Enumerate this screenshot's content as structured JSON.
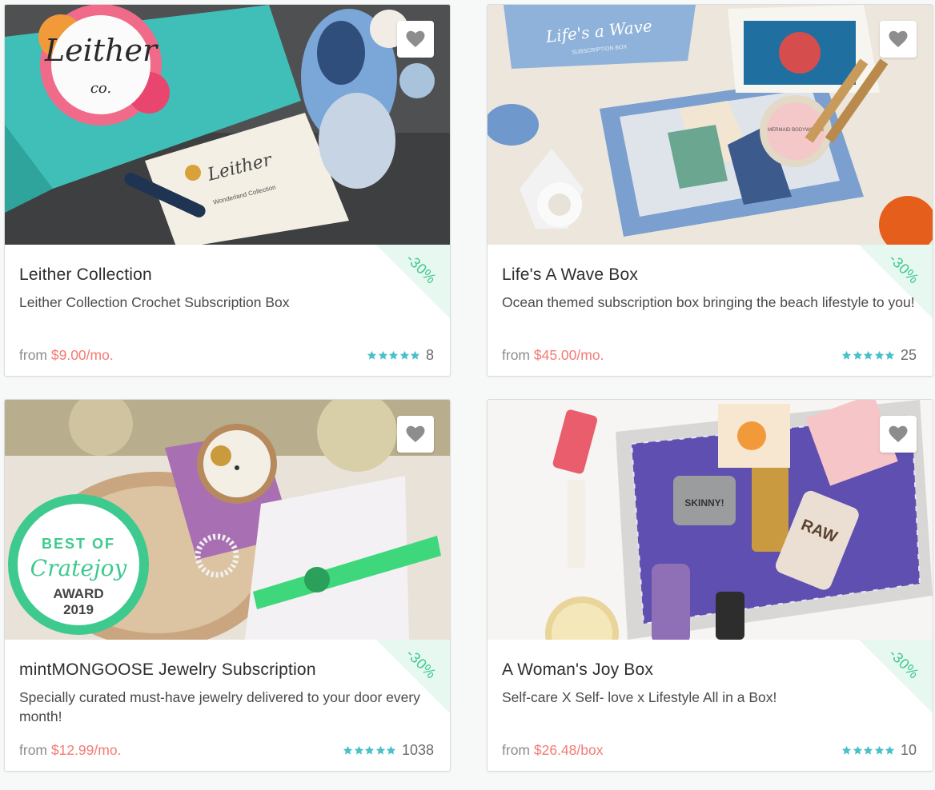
{
  "colors": {
    "accent": "#3ec98e",
    "price": "#f47b73",
    "star": "#4ac0c8"
  },
  "cards": [
    {
      "title": "Leither Collection",
      "description": "Leither Collection Crochet Subscription Box",
      "discount": "-30%",
      "price_prefix": "from",
      "price": "$9.00",
      "price_unit": "/mo.",
      "rating": 5,
      "reviews": "8",
      "logo_text": "Leither",
      "logo_sub": "co.",
      "card_text": "Wonderland Collection"
    },
    {
      "title": "Life's A Wave Box",
      "description": "Ocean themed subscription box bringing the beach lifestyle to you!",
      "discount": "-30%",
      "price_prefix": "from",
      "price": "$45.00",
      "price_unit": "/mo.",
      "rating": 5,
      "reviews": "25",
      "logo_text": "Life's a Wave",
      "logo_sub": "SUBSCRIPTION BOX",
      "badge_text": "MERMAID BODYWORKS"
    },
    {
      "title": "mintMONGOOSE Jewelry Subscription",
      "description": "Specially curated must-have jewelry delivered to your door every month!",
      "discount": "-30%",
      "price_prefix": "from",
      "price": "$12.99",
      "price_unit": "/mo.",
      "rating": 5,
      "reviews": "1038",
      "award_top": "BEST OF",
      "award_brand": "Cratejoy",
      "award_bottom": "AWARD",
      "award_year": "2019"
    },
    {
      "title": "A Woman's Joy Box",
      "description": "Self-care X Self- love x Lifestyle All in a Box!",
      "discount": "-30%",
      "price_prefix": "from",
      "price": "$26.48",
      "price_unit": "/box",
      "rating": 5,
      "reviews": "10",
      "jar_text": "SKINNY!",
      "tube_text": "RAW"
    }
  ]
}
